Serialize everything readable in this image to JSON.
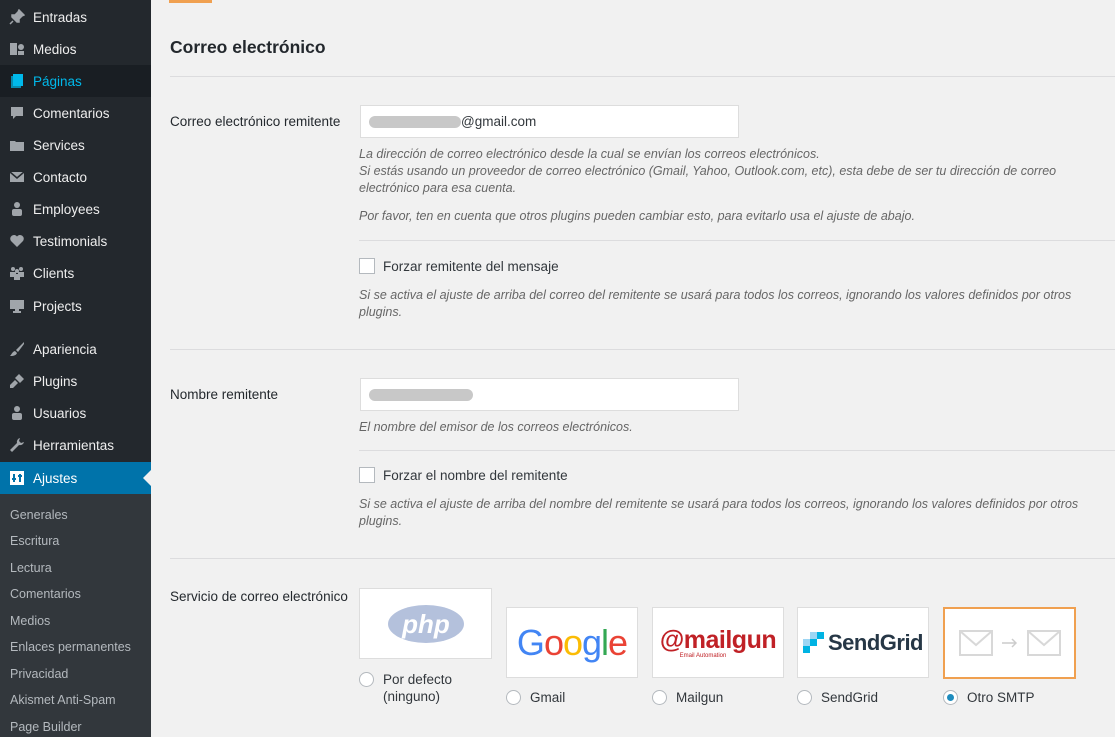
{
  "sidebar": {
    "items": [
      {
        "label": "Entradas",
        "icon": "pushpin-icon"
      },
      {
        "label": "Medios",
        "icon": "media-icon"
      },
      {
        "label": "Páginas",
        "icon": "pages-icon"
      },
      {
        "label": "Comentarios",
        "icon": "comment-icon"
      },
      {
        "label": "Services",
        "icon": "portfolio-icon"
      },
      {
        "label": "Contacto",
        "icon": "envelope-icon"
      },
      {
        "label": "Employees",
        "icon": "person-icon"
      },
      {
        "label": "Testimonials",
        "icon": "heart-icon"
      },
      {
        "label": "Clients",
        "icon": "groups-icon"
      },
      {
        "label": "Projects",
        "icon": "desktop-icon"
      },
      {
        "label": "Apariencia",
        "icon": "paintbrush-icon"
      },
      {
        "label": "Plugins",
        "icon": "plugin-icon"
      },
      {
        "label": "Usuarios",
        "icon": "users-icon"
      },
      {
        "label": "Herramientas",
        "icon": "wrench-icon"
      },
      {
        "label": "Ajustes",
        "icon": "settings-icon"
      }
    ],
    "submenu": [
      "Generales",
      "Escritura",
      "Lectura",
      "Comentarios",
      "Medios",
      "Enlaces permanentes",
      "Privacidad",
      "Akismet Anti-Spam",
      "Page Builder"
    ]
  },
  "main": {
    "section_title": "Correo electrónico",
    "from_email": {
      "label": "Correo electrónico remitente",
      "value_suffix": "@gmail.com",
      "desc1": "La dirección de correo electrónico desde la cual se envían los correos electrónicos.",
      "desc2": "Si estás usando un proveedor de correo electrónico (Gmail, Yahoo, Outlook.com, etc), esta debe de ser tu dirección de correo electrónico para esa cuenta.",
      "desc3": "Por favor, ten en cuenta que otros plugins pueden cambiar esto, para evitarlo usa el ajuste de abajo.",
      "force_label": "Forzar remitente del mensaje",
      "force_desc": "Si se activa el ajuste de arriba del correo del remitente se usará para todos los correos, ignorando los valores definidos por otros plugins."
    },
    "from_name": {
      "label": "Nombre remitente",
      "desc": "El nombre del emisor de los correos electrónicos.",
      "force_label": "Forzar el nombre del remitente",
      "force_desc": "Si se activa el ajuste de arriba del nombre del remitente se usará para todos los correos, ignorando los valores definidos por otros plugins."
    },
    "mailer": {
      "label": "Servicio de correo electrónico",
      "options": [
        {
          "logo": "php",
          "label": "Por defecto (ninguno)",
          "selected": false
        },
        {
          "logo": "Google",
          "label": "Gmail",
          "selected": false
        },
        {
          "logo": "@mailgun",
          "sublogo": "Email Automation",
          "label": "Mailgun",
          "selected": false
        },
        {
          "logo": "SendGrid",
          "label": "SendGrid",
          "selected": false
        },
        {
          "logo": "smtp-envelopes",
          "label": "Otro SMTP",
          "selected": true
        }
      ]
    }
  },
  "colors": {
    "sidebar_bg": "#23282d",
    "active_bg": "#0073aa",
    "accent_orange": "#f0a050",
    "link_blue": "#00b9eb"
  }
}
